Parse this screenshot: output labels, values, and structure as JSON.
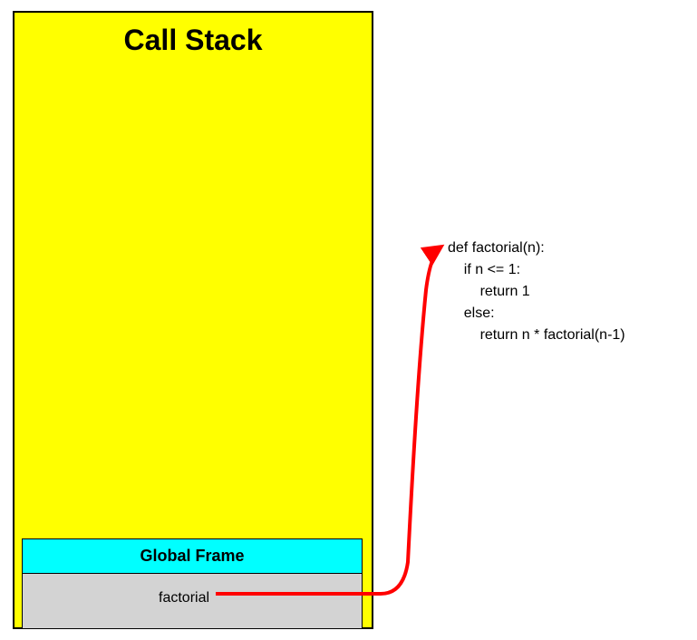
{
  "stack": {
    "title": "Call Stack",
    "frame": {
      "header": "Global Frame",
      "variable": "factorial"
    }
  },
  "code": {
    "line1": "def factorial(n):",
    "line2": "    if n <= 1:",
    "line3": "        return 1",
    "line4": "    else:",
    "line5": "        return n * factorial(n-1)"
  },
  "colors": {
    "stack_bg": "#ffff00",
    "frame_header_bg": "#00ffff",
    "frame_body_bg": "#d3d3d3",
    "arrow": "#ff0000"
  }
}
